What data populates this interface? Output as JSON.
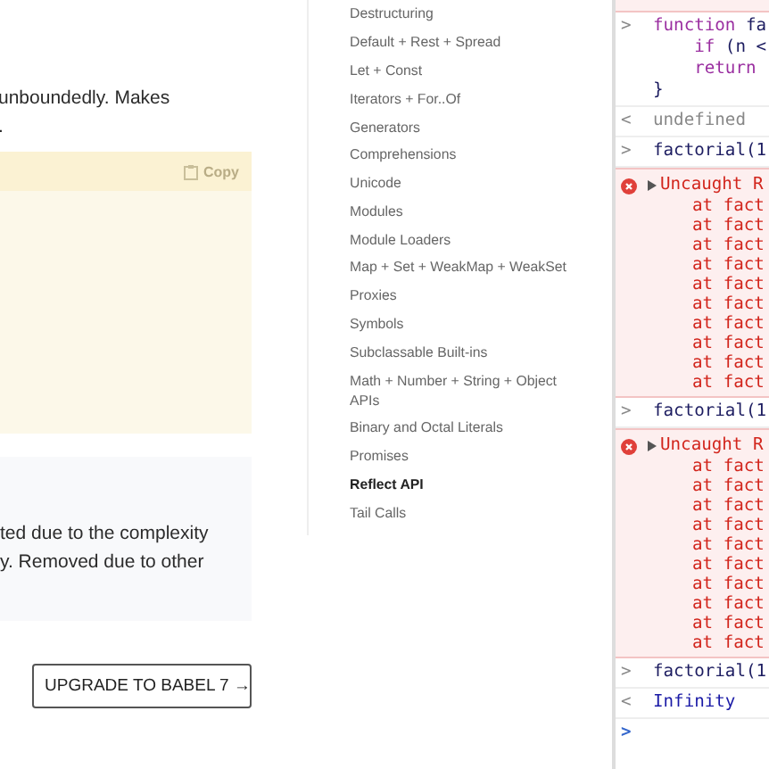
{
  "article": {
    "paragraph_lines": [
      "unboundedly. Makes",
      "."
    ],
    "code_block": {
      "copy_label": "Copy"
    },
    "note_lines": [
      "ted due to the complexity",
      "y. Removed due to other"
    ],
    "upgrade_button": "UPGRADE TO BABEL 7 →"
  },
  "sidebar": {
    "items": [
      {
        "label": "Destructuring",
        "selected": false
      },
      {
        "label": "Default + Rest + Spread",
        "selected": false
      },
      {
        "label": "Let + Const",
        "selected": false
      },
      {
        "label": "Iterators + For..Of",
        "selected": false
      },
      {
        "label": "Generators",
        "selected": false
      },
      {
        "label": "Comprehensions",
        "selected": false
      },
      {
        "label": "Unicode",
        "selected": false
      },
      {
        "label": "Modules",
        "selected": false
      },
      {
        "label": "Module Loaders",
        "selected": false
      },
      {
        "label": "Map + Set + WeakMap + WeakSet",
        "selected": false
      },
      {
        "label": "Proxies",
        "selected": false
      },
      {
        "label": "Symbols",
        "selected": false
      },
      {
        "label": "Subclassable Built-ins",
        "selected": false
      },
      {
        "label": "Math + Number + String + Object APIs",
        "selected": false
      },
      {
        "label": "Binary and Octal Literals",
        "selected": false
      },
      {
        "label": "Promises",
        "selected": false
      },
      {
        "label": "Reflect API",
        "selected": true
      },
      {
        "label": "Tail Calls",
        "selected": false
      }
    ]
  },
  "console": {
    "entries": [
      {
        "kind": "error_end"
      },
      {
        "kind": "input",
        "marker": ">",
        "lines": [
          [
            {
              "t": "function",
              "kind": "keyword"
            },
            {
              "t": " fa",
              "kind": "plain"
            }
          ],
          [
            {
              "t": "    if",
              "kind": "keyword"
            },
            {
              "t": " (n <",
              "kind": "plain"
            }
          ],
          [
            {
              "t": "    return",
              "kind": "keyword"
            }
          ],
          [
            {
              "t": "}",
              "kind": "plain"
            }
          ]
        ]
      },
      {
        "kind": "output_undefined",
        "marker": "<",
        "text": "undefined"
      },
      {
        "kind": "input",
        "marker": ">",
        "lines": [
          [
            {
              "t": "factorial(1",
              "kind": "plain"
            }
          ]
        ]
      },
      {
        "kind": "error",
        "head": "Uncaught R",
        "lines": [
          "at fact",
          "at fact",
          "at fact",
          "at fact",
          "at fact",
          "at fact",
          "at fact",
          "at fact",
          "at fact",
          "at fact"
        ]
      },
      {
        "kind": "input",
        "marker": ">",
        "lines": [
          [
            {
              "t": "factorial(1",
              "kind": "plain"
            }
          ]
        ]
      },
      {
        "kind": "error",
        "head": "Uncaught R",
        "lines": [
          "at fact",
          "at fact",
          "at fact",
          "at fact",
          "at fact",
          "at fact",
          "at fact",
          "at fact",
          "at fact",
          "at fact"
        ]
      },
      {
        "kind": "input",
        "marker": ">",
        "lines": [
          [
            {
              "t": "factorial(1",
              "kind": "plain"
            }
          ]
        ]
      },
      {
        "kind": "output_number",
        "marker": "<",
        "text": "Infinity"
      },
      {
        "kind": "prompt",
        "marker": ">"
      }
    ]
  }
}
